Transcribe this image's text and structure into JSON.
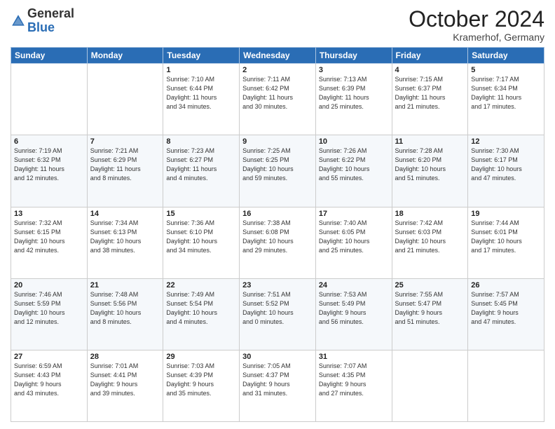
{
  "header": {
    "logo_general": "General",
    "logo_blue": "Blue",
    "month": "October 2024",
    "location": "Kramerhof, Germany"
  },
  "days_of_week": [
    "Sunday",
    "Monday",
    "Tuesday",
    "Wednesday",
    "Thursday",
    "Friday",
    "Saturday"
  ],
  "weeks": [
    [
      {
        "day": "",
        "info": ""
      },
      {
        "day": "",
        "info": ""
      },
      {
        "day": "1",
        "info": "Sunrise: 7:10 AM\nSunset: 6:44 PM\nDaylight: 11 hours\nand 34 minutes."
      },
      {
        "day": "2",
        "info": "Sunrise: 7:11 AM\nSunset: 6:42 PM\nDaylight: 11 hours\nand 30 minutes."
      },
      {
        "day": "3",
        "info": "Sunrise: 7:13 AM\nSunset: 6:39 PM\nDaylight: 11 hours\nand 25 minutes."
      },
      {
        "day": "4",
        "info": "Sunrise: 7:15 AM\nSunset: 6:37 PM\nDaylight: 11 hours\nand 21 minutes."
      },
      {
        "day": "5",
        "info": "Sunrise: 7:17 AM\nSunset: 6:34 PM\nDaylight: 11 hours\nand 17 minutes."
      }
    ],
    [
      {
        "day": "6",
        "info": "Sunrise: 7:19 AM\nSunset: 6:32 PM\nDaylight: 11 hours\nand 12 minutes."
      },
      {
        "day": "7",
        "info": "Sunrise: 7:21 AM\nSunset: 6:29 PM\nDaylight: 11 hours\nand 8 minutes."
      },
      {
        "day": "8",
        "info": "Sunrise: 7:23 AM\nSunset: 6:27 PM\nDaylight: 11 hours\nand 4 minutes."
      },
      {
        "day": "9",
        "info": "Sunrise: 7:25 AM\nSunset: 6:25 PM\nDaylight: 10 hours\nand 59 minutes."
      },
      {
        "day": "10",
        "info": "Sunrise: 7:26 AM\nSunset: 6:22 PM\nDaylight: 10 hours\nand 55 minutes."
      },
      {
        "day": "11",
        "info": "Sunrise: 7:28 AM\nSunset: 6:20 PM\nDaylight: 10 hours\nand 51 minutes."
      },
      {
        "day": "12",
        "info": "Sunrise: 7:30 AM\nSunset: 6:17 PM\nDaylight: 10 hours\nand 47 minutes."
      }
    ],
    [
      {
        "day": "13",
        "info": "Sunrise: 7:32 AM\nSunset: 6:15 PM\nDaylight: 10 hours\nand 42 minutes."
      },
      {
        "day": "14",
        "info": "Sunrise: 7:34 AM\nSunset: 6:13 PM\nDaylight: 10 hours\nand 38 minutes."
      },
      {
        "day": "15",
        "info": "Sunrise: 7:36 AM\nSunset: 6:10 PM\nDaylight: 10 hours\nand 34 minutes."
      },
      {
        "day": "16",
        "info": "Sunrise: 7:38 AM\nSunset: 6:08 PM\nDaylight: 10 hours\nand 29 minutes."
      },
      {
        "day": "17",
        "info": "Sunrise: 7:40 AM\nSunset: 6:05 PM\nDaylight: 10 hours\nand 25 minutes."
      },
      {
        "day": "18",
        "info": "Sunrise: 7:42 AM\nSunset: 6:03 PM\nDaylight: 10 hours\nand 21 minutes."
      },
      {
        "day": "19",
        "info": "Sunrise: 7:44 AM\nSunset: 6:01 PM\nDaylight: 10 hours\nand 17 minutes."
      }
    ],
    [
      {
        "day": "20",
        "info": "Sunrise: 7:46 AM\nSunset: 5:59 PM\nDaylight: 10 hours\nand 12 minutes."
      },
      {
        "day": "21",
        "info": "Sunrise: 7:48 AM\nSunset: 5:56 PM\nDaylight: 10 hours\nand 8 minutes."
      },
      {
        "day": "22",
        "info": "Sunrise: 7:49 AM\nSunset: 5:54 PM\nDaylight: 10 hours\nand 4 minutes."
      },
      {
        "day": "23",
        "info": "Sunrise: 7:51 AM\nSunset: 5:52 PM\nDaylight: 10 hours\nand 0 minutes."
      },
      {
        "day": "24",
        "info": "Sunrise: 7:53 AM\nSunset: 5:49 PM\nDaylight: 9 hours\nand 56 minutes."
      },
      {
        "day": "25",
        "info": "Sunrise: 7:55 AM\nSunset: 5:47 PM\nDaylight: 9 hours\nand 51 minutes."
      },
      {
        "day": "26",
        "info": "Sunrise: 7:57 AM\nSunset: 5:45 PM\nDaylight: 9 hours\nand 47 minutes."
      }
    ],
    [
      {
        "day": "27",
        "info": "Sunrise: 6:59 AM\nSunset: 4:43 PM\nDaylight: 9 hours\nand 43 minutes."
      },
      {
        "day": "28",
        "info": "Sunrise: 7:01 AM\nSunset: 4:41 PM\nDaylight: 9 hours\nand 39 minutes."
      },
      {
        "day": "29",
        "info": "Sunrise: 7:03 AM\nSunset: 4:39 PM\nDaylight: 9 hours\nand 35 minutes."
      },
      {
        "day": "30",
        "info": "Sunrise: 7:05 AM\nSunset: 4:37 PM\nDaylight: 9 hours\nand 31 minutes."
      },
      {
        "day": "31",
        "info": "Sunrise: 7:07 AM\nSunset: 4:35 PM\nDaylight: 9 hours\nand 27 minutes."
      },
      {
        "day": "",
        "info": ""
      },
      {
        "day": "",
        "info": ""
      }
    ]
  ]
}
